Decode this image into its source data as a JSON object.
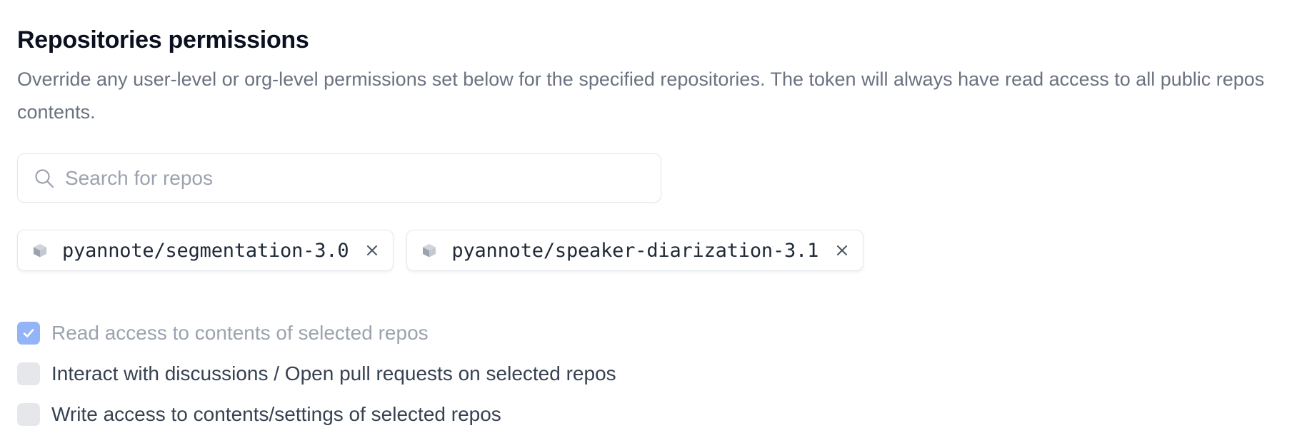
{
  "section": {
    "title": "Repositories permissions",
    "description": "Override any user-level or org-level permissions set below for the specified repositories. The token will always have read access to all public repos contents."
  },
  "search": {
    "placeholder": "Search for repos",
    "value": "",
    "icon": "search-icon"
  },
  "selected_repos": [
    {
      "name": "pyannote/segmentation-3.0",
      "icon": "cube-icon",
      "remove_icon": "close-icon"
    },
    {
      "name": "pyannote/speaker-diarization-3.1",
      "icon": "cube-icon",
      "remove_icon": "close-icon"
    }
  ],
  "permissions": [
    {
      "label": "Read access to contents of selected repos",
      "checked": true,
      "disabled": true
    },
    {
      "label": "Interact with discussions / Open pull requests on selected repos",
      "checked": false,
      "disabled": false
    },
    {
      "label": "Write access to contents/settings of selected repos",
      "checked": false,
      "disabled": false
    }
  ],
  "colors": {
    "checkbox_checked": "#93b4f8",
    "checkbox_unchecked": "#e5e7eb",
    "muted_text": "#6b7280",
    "disabled_text": "#9ca3af"
  }
}
